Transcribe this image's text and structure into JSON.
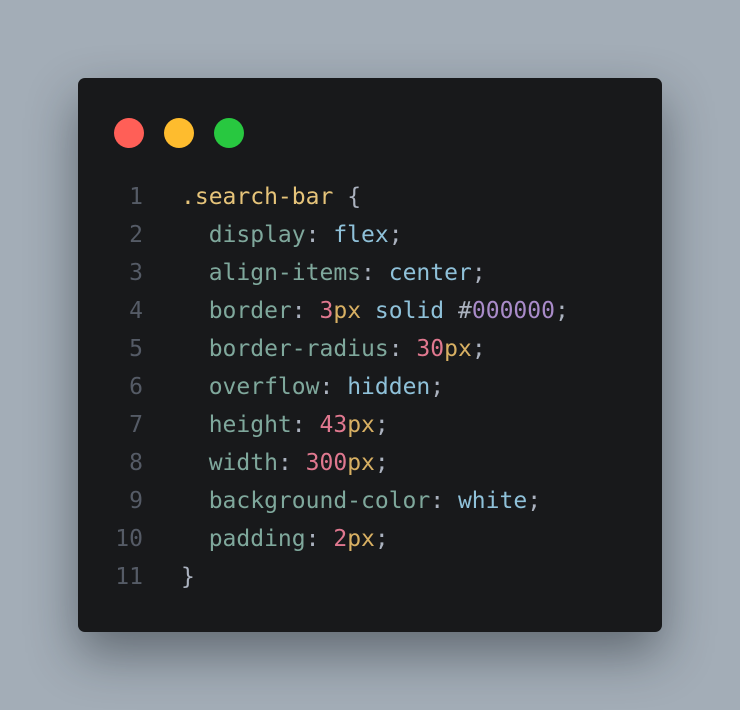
{
  "colors": {
    "background": "#a3adb7",
    "editor": "#18191b",
    "line_number": "#555b66",
    "selector": "#e6c47a",
    "property": "#7fa89c",
    "punctuation": "#abb2bf",
    "keyword": "#8fc1d9",
    "number": "#e0788f",
    "unit": "#d8b063",
    "hex": "#a98bc9",
    "dot_red": "#ff5f57",
    "dot_yellow": "#febc2e",
    "dot_green": "#28c840"
  },
  "window_controls": [
    {
      "name": "close-dot",
      "color": "#ff5f57"
    },
    {
      "name": "minimize-dot",
      "color": "#febc2e"
    },
    {
      "name": "maximize-dot",
      "color": "#28c840"
    }
  ],
  "code": {
    "lines": [
      {
        "n": "1",
        "tokens": [
          {
            "t": ".search-bar",
            "k": "selector"
          },
          {
            "t": " ",
            "k": "punctuation"
          },
          {
            "t": "{",
            "k": "punctuation"
          }
        ]
      },
      {
        "n": "2",
        "tokens": [
          {
            "t": "  display",
            "k": "property"
          },
          {
            "t": ": ",
            "k": "punctuation"
          },
          {
            "t": "flex",
            "k": "keyword"
          },
          {
            "t": ";",
            "k": "punctuation"
          }
        ]
      },
      {
        "n": "3",
        "tokens": [
          {
            "t": "  align-items",
            "k": "property"
          },
          {
            "t": ": ",
            "k": "punctuation"
          },
          {
            "t": "center",
            "k": "keyword"
          },
          {
            "t": ";",
            "k": "punctuation"
          }
        ]
      },
      {
        "n": "4",
        "tokens": [
          {
            "t": "  border",
            "k": "property"
          },
          {
            "t": ": ",
            "k": "punctuation"
          },
          {
            "t": "3",
            "k": "number"
          },
          {
            "t": "px",
            "k": "unit"
          },
          {
            "t": " ",
            "k": "punctuation"
          },
          {
            "t": "solid",
            "k": "keyword"
          },
          {
            "t": " ",
            "k": "punctuation"
          },
          {
            "t": "#",
            "k": "punctuation"
          },
          {
            "t": "000000",
            "k": "hex"
          },
          {
            "t": ";",
            "k": "punctuation"
          }
        ]
      },
      {
        "n": "5",
        "tokens": [
          {
            "t": "  border-radius",
            "k": "property"
          },
          {
            "t": ": ",
            "k": "punctuation"
          },
          {
            "t": "30",
            "k": "number"
          },
          {
            "t": "px",
            "k": "unit"
          },
          {
            "t": ";",
            "k": "punctuation"
          }
        ]
      },
      {
        "n": "6",
        "tokens": [
          {
            "t": "  overflow",
            "k": "property"
          },
          {
            "t": ": ",
            "k": "punctuation"
          },
          {
            "t": "hidden",
            "k": "keyword"
          },
          {
            "t": ";",
            "k": "punctuation"
          }
        ]
      },
      {
        "n": "7",
        "tokens": [
          {
            "t": "  height",
            "k": "property"
          },
          {
            "t": ": ",
            "k": "punctuation"
          },
          {
            "t": "43",
            "k": "number"
          },
          {
            "t": "px",
            "k": "unit"
          },
          {
            "t": ";",
            "k": "punctuation"
          }
        ]
      },
      {
        "n": "8",
        "tokens": [
          {
            "t": "  width",
            "k": "property"
          },
          {
            "t": ": ",
            "k": "punctuation"
          },
          {
            "t": "300",
            "k": "number"
          },
          {
            "t": "px",
            "k": "unit"
          },
          {
            "t": ";",
            "k": "punctuation"
          }
        ]
      },
      {
        "n": "9",
        "tokens": [
          {
            "t": "  background-color",
            "k": "property"
          },
          {
            "t": ": ",
            "k": "punctuation"
          },
          {
            "t": "white",
            "k": "keyword"
          },
          {
            "t": ";",
            "k": "punctuation"
          }
        ]
      },
      {
        "n": "10",
        "tokens": [
          {
            "t": "  padding",
            "k": "property"
          },
          {
            "t": ": ",
            "k": "punctuation"
          },
          {
            "t": "2",
            "k": "number"
          },
          {
            "t": "px",
            "k": "unit"
          },
          {
            "t": ";",
            "k": "punctuation"
          }
        ]
      },
      {
        "n": "11",
        "tokens": [
          {
            "t": "}",
            "k": "punctuation"
          }
        ]
      }
    ]
  }
}
